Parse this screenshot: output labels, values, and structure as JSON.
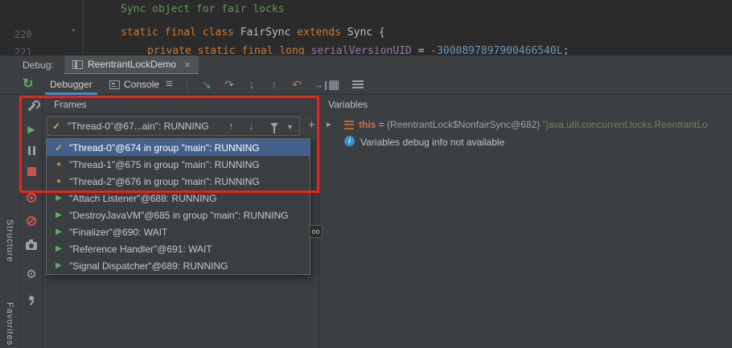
{
  "colors": {
    "accent_blue": "#4A88C7",
    "selection_blue": "#44618e",
    "annotation_red": "#ef2217",
    "keyword_orange": "#cc7832",
    "comment_green": "#629755",
    "thread_running_green": "#5fad65",
    "thread_current_orange": "#e0a54c",
    "stop_red": "#c75450",
    "info_blue": "#3894c9"
  },
  "icons": {
    "fold": "▾",
    "rerun": "↻",
    "hamburger": "≡",
    "grid": "▦",
    "close": "×",
    "up_arrow": "↑",
    "down_arrow": "↓",
    "dropdown_chevron": "▼",
    "plus": "+",
    "check": "✓",
    "dot": "●",
    "run_triangle": "▶",
    "resume": "▶",
    "gear": "⚙",
    "collapsed_chevron": "▸"
  },
  "editor": {
    "comment": "Sync object for fair locks",
    "line220": {
      "number": "220",
      "kw1": "static final class ",
      "cls1": "FairSync ",
      "kw2": "extends ",
      "cls2": "Sync {"
    },
    "line221": {
      "number": "221",
      "kw": "private static final long ",
      "field": "serialVersionUID ",
      "eq": "= ",
      "value": "-3000897897900466540L",
      "semi": ";"
    }
  },
  "debug_header": {
    "label": "Debug:",
    "session_tab": "ReentrantLockDemo"
  },
  "toolbar": {
    "debugger_tab": "Debugger",
    "console_tab": "Console",
    "step_icons": [
      {
        "name": "show-execution-point",
        "glyph": "↘"
      },
      {
        "name": "step-over",
        "glyph": "↷"
      },
      {
        "name": "step-into",
        "glyph": "↓"
      },
      {
        "name": "step-out",
        "glyph": "↑"
      },
      {
        "name": "drop-frame",
        "glyph": "↶"
      },
      {
        "name": "run-to-cursor",
        "glyph": "→"
      }
    ]
  },
  "left_stripe": {
    "structure": "Structure",
    "favorites": "Favorites"
  },
  "frames": {
    "header": "Frames",
    "selector_text": "\"Thread-0\"@67...ain\": RUNNING",
    "dropdown": [
      {
        "icon": "check-icon",
        "label": "\"Thread-0\"@674 in group \"main\": RUNNING",
        "selected": true
      },
      {
        "icon": "thread-dot-icon",
        "label": "\"Thread-1\"@675 in group \"main\": RUNNING"
      },
      {
        "icon": "thread-dot-icon",
        "label": "\"Thread-2\"@676 in group \"main\": RUNNING"
      },
      {
        "icon": "thread-running-icon",
        "label": "\"Attach Listener\"@688: RUNNING"
      },
      {
        "icon": "thread-running-icon",
        "label": "\"DestroyJavaVM\"@685 in group \"main\": RUNNING"
      },
      {
        "icon": "thread-running-icon",
        "label": "\"Finalizer\"@690: WAIT"
      },
      {
        "icon": "thread-running-icon",
        "label": "\"Reference Handler\"@691: WAIT"
      },
      {
        "icon": "thread-running-icon",
        "label": "\"Signal Dispatcher\"@689: RUNNING"
      }
    ]
  },
  "variables": {
    "header": "Variables",
    "this_row": {
      "name": "this",
      "equals": " = ",
      "type_ref": "{ReentrantLock$NonfairSync@682} ",
      "value_preview": "\"java.util.concurrent.locks.ReentrantLo"
    },
    "info_glyph": "i",
    "info_text": "Variables debug info not available"
  },
  "badge": {
    "label": "oo"
  }
}
